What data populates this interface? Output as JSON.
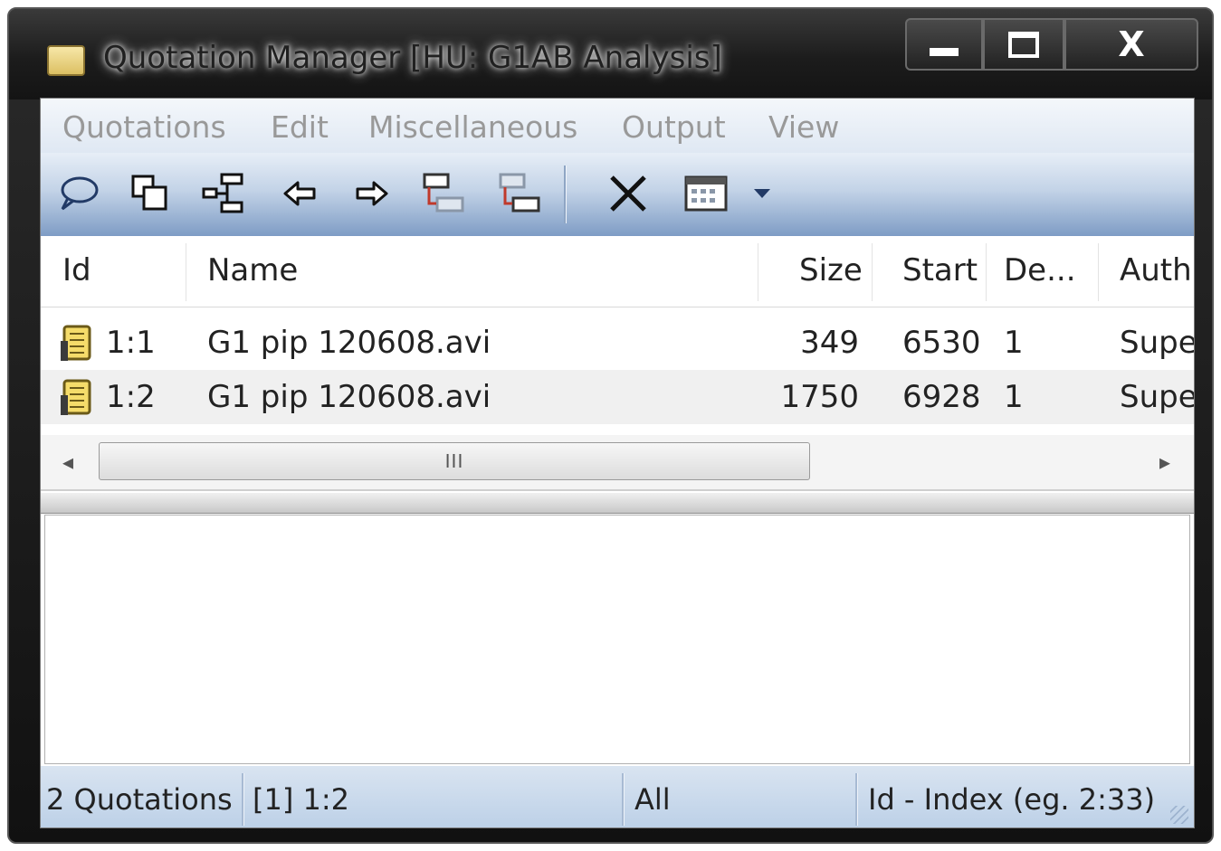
{
  "window": {
    "title": "Quotation Manager [HU: G1AB Analysis]",
    "controls": {
      "minimize": "",
      "maximize": "",
      "close": "X"
    }
  },
  "menu": [
    "Quotations",
    "Edit",
    "Miscellaneous",
    "Output",
    "View"
  ],
  "toolbar": {
    "icons": [
      "speech-bubble-icon",
      "duplicate-icon",
      "hierarchy-icon",
      "arrow-left-icon",
      "arrow-right-icon",
      "link-down-icon",
      "link-up-icon",
      "delete-icon",
      "calendar-icon",
      "dropdown-arrow-icon"
    ]
  },
  "list": {
    "columns": [
      "Id",
      "Name",
      "Size",
      "Start",
      "De...",
      "Auth"
    ],
    "rows": [
      {
        "id": "1:1",
        "name": "G1 pip 120608.avi",
        "size": "349",
        "start": "6530",
        "de": "1",
        "author": "Supe"
      },
      {
        "id": "1:2",
        "name": "G1 pip 120608.avi",
        "size": "1750",
        "start": "6928",
        "de": "1",
        "author": "Supe"
      }
    ]
  },
  "scrollbar": {
    "thumb_label": "III",
    "left_arrow": "◂",
    "right_arrow": "▸"
  },
  "status": {
    "count": "2 Quotations",
    "selection": "[1] 1:2",
    "filter": "All",
    "sort": "Id - Index (eg. 2:33)"
  }
}
